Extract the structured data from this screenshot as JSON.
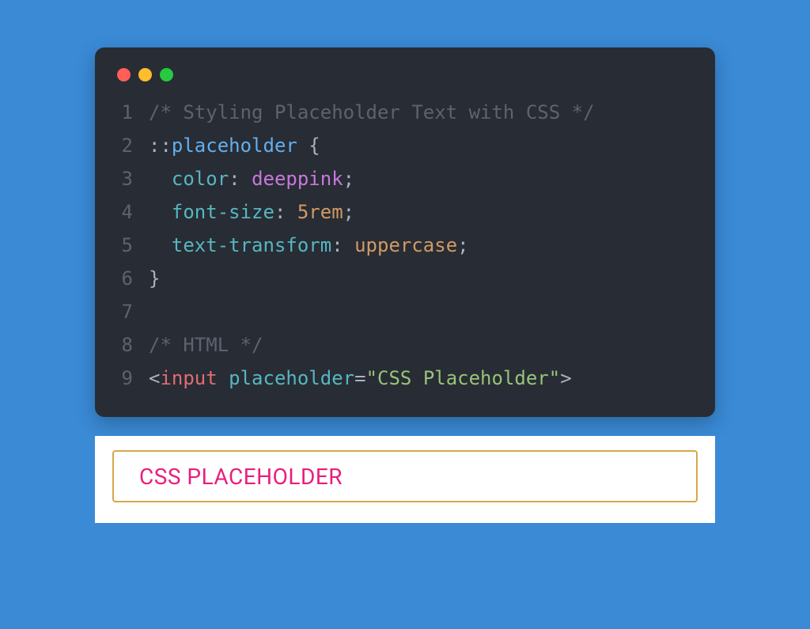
{
  "code": {
    "lines": [
      {
        "n": "1",
        "tokens": [
          {
            "cls": "tok-comment",
            "t": "/* Styling Placeholder Text with CSS */"
          }
        ]
      },
      {
        "n": "2",
        "tokens": [
          {
            "cls": "tok-punct",
            "t": "::"
          },
          {
            "cls": "tok-selector",
            "t": "placeholder"
          },
          {
            "cls": "tok-punct",
            "t": " {"
          }
        ]
      },
      {
        "n": "3",
        "tokens": [
          {
            "cls": "tok-punct",
            "t": "  "
          },
          {
            "cls": "tok-prop",
            "t": "color"
          },
          {
            "cls": "tok-punct",
            "t": ": "
          },
          {
            "cls": "tok-valuekw",
            "t": "deeppink"
          },
          {
            "cls": "tok-punct",
            "t": ";"
          }
        ]
      },
      {
        "n": "4",
        "tokens": [
          {
            "cls": "tok-punct",
            "t": "  "
          },
          {
            "cls": "tok-prop",
            "t": "font-size"
          },
          {
            "cls": "tok-punct",
            "t": ": "
          },
          {
            "cls": "tok-value",
            "t": "5rem"
          },
          {
            "cls": "tok-punct",
            "t": ";"
          }
        ]
      },
      {
        "n": "5",
        "tokens": [
          {
            "cls": "tok-punct",
            "t": "  "
          },
          {
            "cls": "tok-prop",
            "t": "text-transform"
          },
          {
            "cls": "tok-punct",
            "t": ": "
          },
          {
            "cls": "tok-value",
            "t": "uppercase"
          },
          {
            "cls": "tok-punct",
            "t": ";"
          }
        ]
      },
      {
        "n": "6",
        "tokens": [
          {
            "cls": "tok-punct",
            "t": "}"
          }
        ]
      },
      {
        "n": "7",
        "tokens": [
          {
            "cls": "tok-punct",
            "t": ""
          }
        ]
      },
      {
        "n": "8",
        "tokens": [
          {
            "cls": "tok-comment",
            "t": "/* HTML */"
          }
        ]
      },
      {
        "n": "9",
        "tokens": [
          {
            "cls": "tok-angle",
            "t": "<"
          },
          {
            "cls": "tok-tag",
            "t": "input"
          },
          {
            "cls": "tok-punct",
            "t": " "
          },
          {
            "cls": "tok-attr",
            "t": "placeholder"
          },
          {
            "cls": "tok-eq",
            "t": "="
          },
          {
            "cls": "tok-quote",
            "t": "\""
          },
          {
            "cls": "tok-strval",
            "t": "CSS Placeholder"
          },
          {
            "cls": "tok-quote",
            "t": "\""
          },
          {
            "cls": "tok-angle",
            "t": ">"
          }
        ]
      }
    ]
  },
  "preview": {
    "placeholder": "CSS Placeholder"
  }
}
